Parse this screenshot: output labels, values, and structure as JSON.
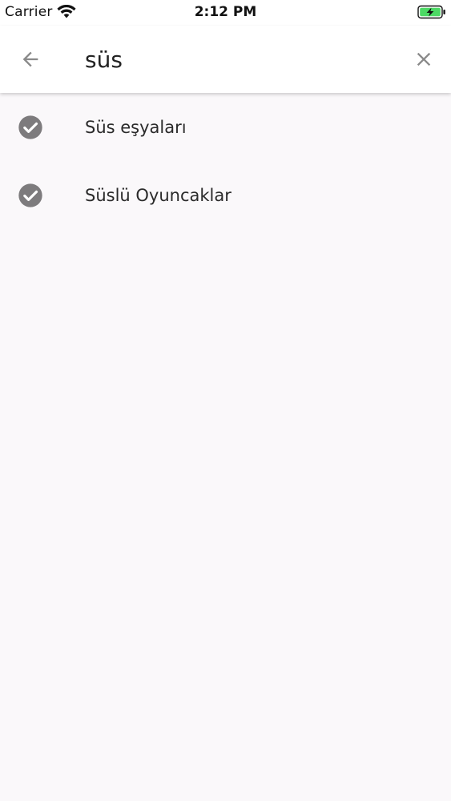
{
  "status_bar": {
    "carrier": "Carrier",
    "time": "2:12 PM",
    "wifi_icon": "wifi-icon",
    "battery_icon": "battery-charging-icon",
    "battery_color": "#4cd964"
  },
  "app_bar": {
    "back_icon": "arrow-back-icon",
    "search_value": "süs",
    "clear_icon": "close-icon",
    "icon_color": "#8a8a8a"
  },
  "results": [
    {
      "label": "Süs eşyaları",
      "icon": "check-circle-icon"
    },
    {
      "label": "Süslü Oyuncaklar",
      "icon": "check-circle-icon"
    }
  ],
  "colors": {
    "background": "#faf8fa",
    "appbar": "#ffffff",
    "check_icon": "#7d7b7d"
  }
}
